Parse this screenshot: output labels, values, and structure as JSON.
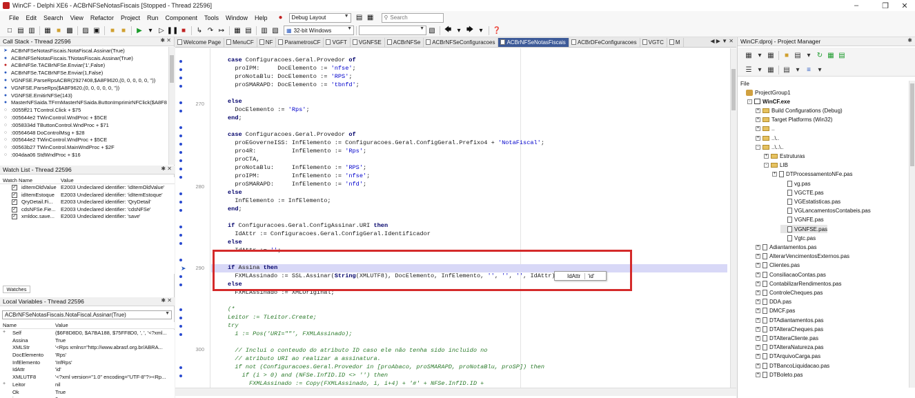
{
  "title": "WinCF - Delphi XE6 - ACBrNFSeNotasFiscais [Stopped - Thread 22596]",
  "menu": [
    "File",
    "Edit",
    "Search",
    "View",
    "Refactor",
    "Project",
    "Run",
    "Component",
    "Tools",
    "Window",
    "Help"
  ],
  "toolbar": {
    "layout_combo": "Debug Layout",
    "search_placeholder": "Search",
    "platform_combo": "32-bit Windows"
  },
  "call_stack": {
    "title": "Call Stack - Thread 22596",
    "rows": [
      "ACBrNFSeNotasFiscais.NotaFiscal.Assinar(True)",
      "ACBrNFSeNotasFiscais.TNotasFiscais.Assinar(True)",
      "ACBrNFSe.TACBrNFSe.Enviar('1',False)",
      "ACBrNFSe.TACBrNFSe.Enviar(1,False)",
      "VGNFSE.ParseRpsACBR(2927408,$A8F9620,(0, 0, 0, 0, 0, ''))",
      "VGNFSE.ParseRps($A8F9620,(0, 0, 0, 0, 0, ''))",
      "VGNFSE.EmitirNFSe(143)",
      "MasterNFSaida.TFrmMasterNFSaida.ButtonImprimirNFClick($A8F8",
      ":0055ff21 TControl.Click + $75",
      ":005644e2 TWinControl.WndProc + $5CE",
      ":0058334d TButtonControl.WndProc + $71",
      ":00564648 DoControlMsg + $28",
      ":005644e2 TWinControl.WndProc + $5CE",
      ":00563b27 TWinControl.MainWndProc + $2F",
      ":004daa06 StdWndProc + $16"
    ]
  },
  "watch_list": {
    "title": "Watch List - Thread 22596",
    "col_name": "Watch Name",
    "col_value": "Value",
    "rows": [
      {
        "name": "idItemOldValue",
        "value": "E2003 Undeclared identifier: 'idItemOldValue'"
      },
      {
        "name": "idItemEstoque",
        "value": "E2003 Undeclared identifier: 'idItemEstoque'"
      },
      {
        "name": "QryDetail.Fi...",
        "value": "E2003 Undeclared identifier: 'QryDetail'"
      },
      {
        "name": "cdsNFSe.Fie...",
        "value": "E2003 Undeclared identifier: 'cdsNFSe'"
      },
      {
        "name": "xmldoc.save...",
        "value": "E2003 Undeclared identifier: 'save'"
      }
    ],
    "tab": "Watches"
  },
  "locals": {
    "title": "Local Variables - Thread 22596",
    "combo": "ACBrNFSeNotasFiscais.NotaFiscal.Assinar(True)",
    "col_name": "Name",
    "col_value": "Value",
    "rows": [
      {
        "exp": "+",
        "name": "Self",
        "value": "($6F8D8D0, $A7BA188, $75FF8D0, ', ', '<?xml..."
      },
      {
        "exp": "",
        "name": "Assina",
        "value": "True"
      },
      {
        "exp": "",
        "name": "XMLStr",
        "value": "'<Rps xmlns=\"http://www.abrasf.org.br/ABRA..."
      },
      {
        "exp": "",
        "name": "DocElemento",
        "value": "'Rps'"
      },
      {
        "exp": "",
        "name": "InfElemento",
        "value": "'InfRps'"
      },
      {
        "exp": "",
        "name": "IdAttr",
        "value": "'id'"
      },
      {
        "exp": "",
        "name": "XMLUTF8",
        "value": "'<?xml version=\"1.0\" encoding=\"UTF-8\"?><Rp..."
      },
      {
        "exp": "+",
        "name": "Leitor",
        "value": "nil"
      },
      {
        "exp": "",
        "name": "Ok",
        "value": "True"
      },
      {
        "exp": "",
        "name": "i",
        "value": "0"
      }
    ]
  },
  "editor": {
    "tabs": [
      "Welcome Page",
      "MenuCF",
      "NF",
      "ParametrosCF",
      "VGFT",
      "VGNFSE",
      "ACBrNFSe",
      "ACBrNFSeConfiguracoes",
      "ACBrNFSeNotasFiscais",
      "ACBrDFeConfiguracoes",
      "VGTC",
      "M"
    ],
    "active_tab": "ACBrNFSeNotasFiscais",
    "line_numbers": [
      "270",
      "280",
      "290",
      "300"
    ],
    "tooltip": {
      "a": "IdAttr",
      "b": "'id'"
    }
  },
  "project_manager": {
    "title": "WinCF.dproj - Project Manager",
    "file_label": "File",
    "tree": [
      {
        "exp": "",
        "icon": "group",
        "label": "ProjectGroup1",
        "indent": 0
      },
      {
        "exp": "-",
        "icon": "proj",
        "label": "WinCF.exe",
        "indent": 1,
        "bold": true
      },
      {
        "exp": "+",
        "icon": "folder",
        "label": "Build Configurations (Debug)",
        "indent": 2
      },
      {
        "exp": "+",
        "icon": "folder",
        "label": "Target Platforms (Win32)",
        "indent": 2
      },
      {
        "exp": "+",
        "icon": "folder",
        "label": "..",
        "indent": 2
      },
      {
        "exp": "+",
        "icon": "folder",
        "label": "..\\..",
        "indent": 2
      },
      {
        "exp": "-",
        "icon": "folder",
        "label": "..\\..\\..",
        "indent": 2
      },
      {
        "exp": "+",
        "icon": "folder",
        "label": "Estruturas",
        "indent": 3
      },
      {
        "exp": "-",
        "icon": "folder",
        "label": "LIB",
        "indent": 3
      },
      {
        "exp": "+",
        "icon": "file",
        "label": "DTProcessamentoNFe.pas",
        "indent": 4
      },
      {
        "exp": "",
        "icon": "file",
        "label": "vg.pas",
        "indent": 5
      },
      {
        "exp": "",
        "icon": "file",
        "label": "VGCTE.pas",
        "indent": 5
      },
      {
        "exp": "",
        "icon": "file",
        "label": "VGEstatisticas.pas",
        "indent": 5
      },
      {
        "exp": "",
        "icon": "file",
        "label": "VGLancamentosContabeis.pas",
        "indent": 5
      },
      {
        "exp": "",
        "icon": "file",
        "label": "VGNFE.pas",
        "indent": 5
      },
      {
        "exp": "",
        "icon": "file",
        "label": "VGNFSE.pas",
        "indent": 5,
        "selected": true
      },
      {
        "exp": "",
        "icon": "file",
        "label": "Vgtc.pas",
        "indent": 5
      },
      {
        "exp": "+",
        "icon": "file",
        "label": "Adiantamentos.pas",
        "indent": 2
      },
      {
        "exp": "+",
        "icon": "file",
        "label": "AlterarVencimentosExternos.pas",
        "indent": 2
      },
      {
        "exp": "+",
        "icon": "file",
        "label": "Clientes.pas",
        "indent": 2
      },
      {
        "exp": "+",
        "icon": "file",
        "label": "ConsiliacaoContas.pas",
        "indent": 2
      },
      {
        "exp": "+",
        "icon": "file",
        "label": "ContabilizarRendimentos.pas",
        "indent": 2
      },
      {
        "exp": "+",
        "icon": "file",
        "label": "ControleCheques.pas",
        "indent": 2
      },
      {
        "exp": "+",
        "icon": "file",
        "label": "DDA.pas",
        "indent": 2
      },
      {
        "exp": "+",
        "icon": "file",
        "label": "DMCF.pas",
        "indent": 2
      },
      {
        "exp": "+",
        "icon": "file",
        "label": "DTAdiantamentos.pas",
        "indent": 2
      },
      {
        "exp": "+",
        "icon": "file",
        "label": "DTAlteraCheques.pas",
        "indent": 2
      },
      {
        "exp": "+",
        "icon": "file",
        "label": "DTAlteraCliente.pas",
        "indent": 2
      },
      {
        "exp": "+",
        "icon": "file",
        "label": "DTAlteraNatureza.pas",
        "indent": 2
      },
      {
        "exp": "+",
        "icon": "file",
        "label": "DTArquivoCarga.pas",
        "indent": 2
      },
      {
        "exp": "+",
        "icon": "file",
        "label": "DTBancoLiquidacao.pas",
        "indent": 2
      },
      {
        "exp": "+",
        "icon": "file",
        "label": "DTBoleto.pas",
        "indent": 2
      }
    ]
  },
  "colors": {
    "active_tab": "#3d5a98",
    "highlight": "#d8d8f7",
    "redbox": "#d42a2a",
    "keyword": "#00006a",
    "string": "#0000cc",
    "comment": "#2a7a2a"
  }
}
